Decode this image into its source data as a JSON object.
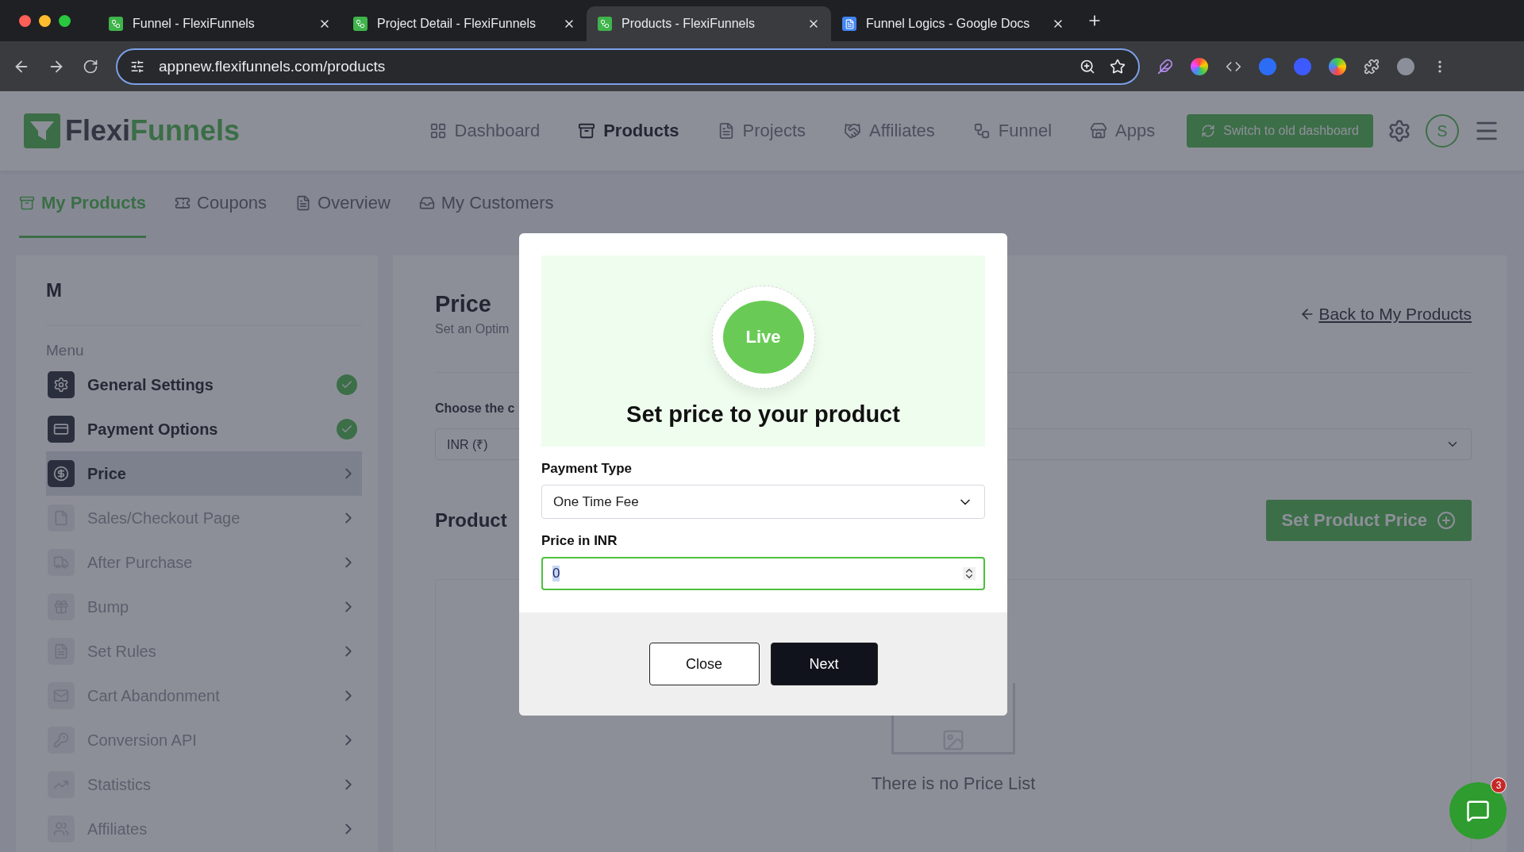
{
  "browser": {
    "tabs": [
      {
        "title": "Funnel - FlexiFunnels",
        "kind": "app",
        "selected": false
      },
      {
        "title": "Project Detail - FlexiFunnels",
        "kind": "app",
        "selected": false
      },
      {
        "title": "Products - FlexiFunnels",
        "kind": "app",
        "selected": true
      },
      {
        "title": "Funnel Logics - Google Docs",
        "kind": "doc",
        "selected": false
      }
    ],
    "url": "appnew.flexifunnels.com/products"
  },
  "header": {
    "logo": {
      "first": "Flexi",
      "second": "Funnels"
    },
    "nav": [
      {
        "label": "Dashboard",
        "selected": false
      },
      {
        "label": "Products",
        "selected": true
      },
      {
        "label": "Projects",
        "selected": false
      },
      {
        "label": "Affiliates",
        "selected": false
      },
      {
        "label": "Funnel",
        "selected": false
      },
      {
        "label": "Apps",
        "selected": false
      }
    ],
    "switch_button": "Switch to old dashboard",
    "avatar": "S"
  },
  "subtabs": [
    {
      "label": "My Products",
      "selected": true
    },
    {
      "label": "Coupons",
      "selected": false
    },
    {
      "label": "Overview",
      "selected": false
    },
    {
      "label": "My Customers",
      "selected": false
    }
  ],
  "sidebar": {
    "title": "M",
    "menu_label": "Menu",
    "items": [
      {
        "label": "General Settings",
        "enabled": true,
        "done": true,
        "selected": false
      },
      {
        "label": "Payment Options",
        "enabled": true,
        "done": true,
        "selected": false
      },
      {
        "label": "Price",
        "enabled": true,
        "done": false,
        "selected": true
      },
      {
        "label": "Sales/Checkout Page",
        "enabled": false,
        "done": false,
        "selected": false
      },
      {
        "label": "After Purchase",
        "enabled": false,
        "done": false,
        "selected": false
      },
      {
        "label": "Bump",
        "enabled": false,
        "done": false,
        "selected": false
      },
      {
        "label": "Set Rules",
        "enabled": false,
        "done": false,
        "selected": false
      },
      {
        "label": "Cart Abandonment",
        "enabled": false,
        "done": false,
        "selected": false
      },
      {
        "label": "Conversion API",
        "enabled": false,
        "done": false,
        "selected": false
      },
      {
        "label": "Statistics",
        "enabled": false,
        "done": false,
        "selected": false
      },
      {
        "label": "Affiliates",
        "enabled": false,
        "done": false,
        "selected": false
      }
    ]
  },
  "main": {
    "title": "Price",
    "subtitle": "Set an Optim",
    "back_link": "Back to My Products",
    "currency_label": "Choose the c",
    "currency_value": "INR (₹)",
    "section_title": "Product",
    "set_price_button": "Set Product Price",
    "empty_text": "There is no Price List"
  },
  "modal": {
    "badge": "Live",
    "title": "Set price to your product",
    "payment_type": {
      "label": "Payment Type",
      "value": "One Time Fee"
    },
    "price": {
      "label": "Price in INR",
      "value": "0"
    },
    "buttons": [
      {
        "label": "Close",
        "kind": "secondary"
      },
      {
        "label": "Next",
        "kind": "primary"
      }
    ]
  },
  "chat": {
    "badge": "3"
  }
}
